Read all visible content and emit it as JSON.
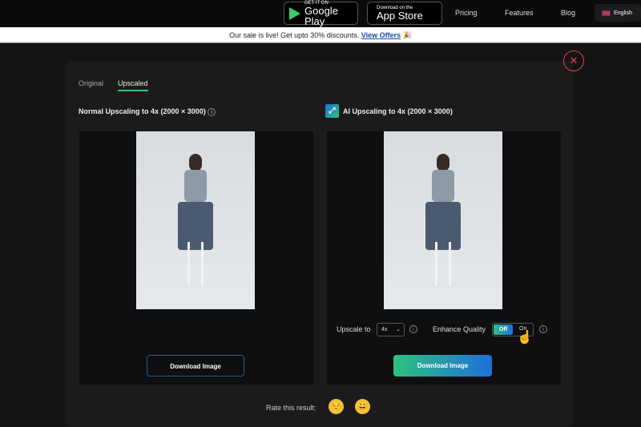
{
  "header": {
    "google_play": {
      "small": "GET IT ON",
      "big": "Google Play"
    },
    "app_store": {
      "small": "Download on the",
      "big": "App Store"
    },
    "nav": [
      "Pricing",
      "Features",
      "Blog"
    ],
    "language": "English"
  },
  "banner": {
    "text": "Our sale is live! Get upto 30% discounts.",
    "link": "View Offers",
    "emoji": "🎉"
  },
  "modal": {
    "tabs": [
      "Original",
      "Upscaled"
    ],
    "active_tab": "Upscaled",
    "left": {
      "title": "Normal Upscaling to 4x (2000 × 3000)",
      "download": "Download Image"
    },
    "right": {
      "title": "AI Upscaling to 4x (2000 × 3000)",
      "download": "Download Image",
      "upscale_label": "Upscale to",
      "upscale_value": "4x",
      "enhance_label": "Enhance Quality",
      "toggle_off": "Off",
      "toggle_on": "On",
      "enhance_state": "Off"
    },
    "rate_label": "Rate this result:",
    "emojis": [
      "😔",
      "😀"
    ]
  },
  "colors": {
    "accent_green": "#2ec27e",
    "accent_blue": "#1e6fd9",
    "close_red": "#e0404f"
  }
}
